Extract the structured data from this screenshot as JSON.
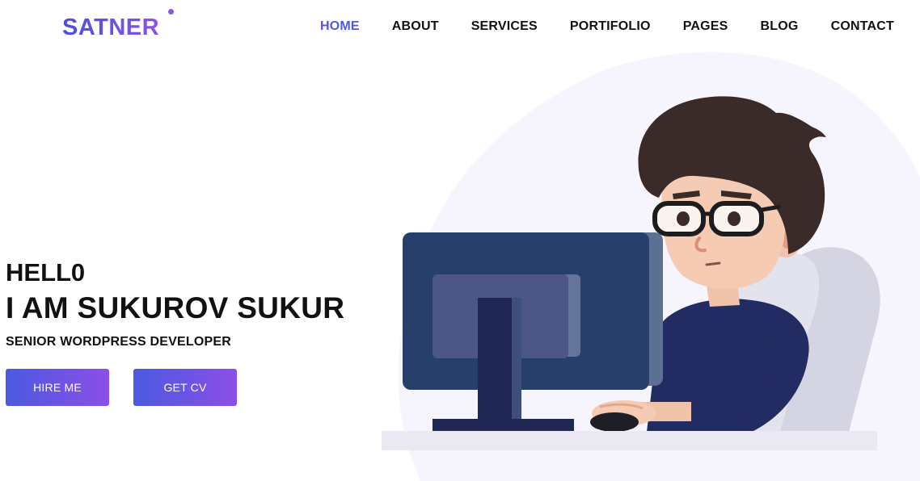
{
  "header": {
    "logo": "SATNER",
    "nav": [
      {
        "label": "HOME",
        "active": true
      },
      {
        "label": "ABOUT",
        "active": false
      },
      {
        "label": "SERVICES",
        "active": false
      },
      {
        "label": "PORTIFOLIO",
        "active": false
      },
      {
        "label": "PAGES",
        "active": false
      },
      {
        "label": "BLOG",
        "active": false
      },
      {
        "label": "CONTACT",
        "active": false
      }
    ]
  },
  "hero": {
    "greeting": "HELL0",
    "name": "I AM SUKUROV SUKUR",
    "role": "SENIOR WORDPRESS DEVELOPER",
    "hire_button": "HIRE ME",
    "cv_button": "GET CV"
  },
  "colors": {
    "accent": "#4e5ad8",
    "gradient_start": "#4a5ae0",
    "gradient_end": "#8b4fe8"
  },
  "icons": {
    "logo_dot": "dot-icon"
  }
}
